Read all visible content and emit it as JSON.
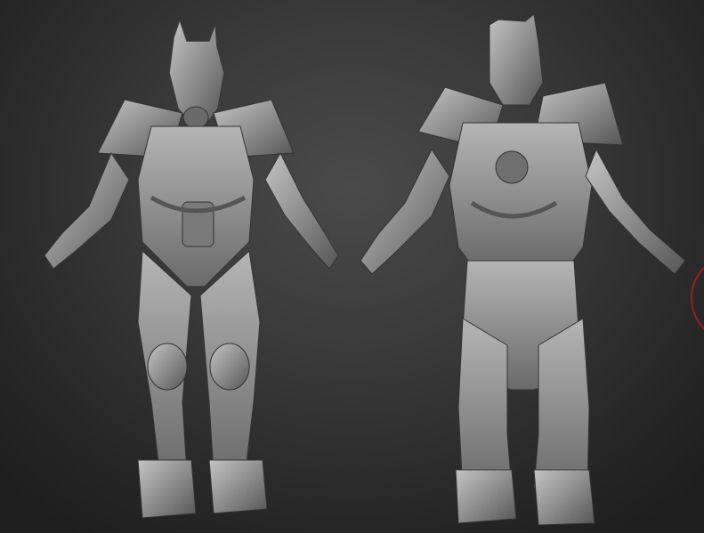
{
  "scene": {
    "background_color": "#333333",
    "model_color": "#9a9a9a",
    "brush_cursor_color": "#9a1f1f",
    "views": [
      "front",
      "back"
    ]
  }
}
